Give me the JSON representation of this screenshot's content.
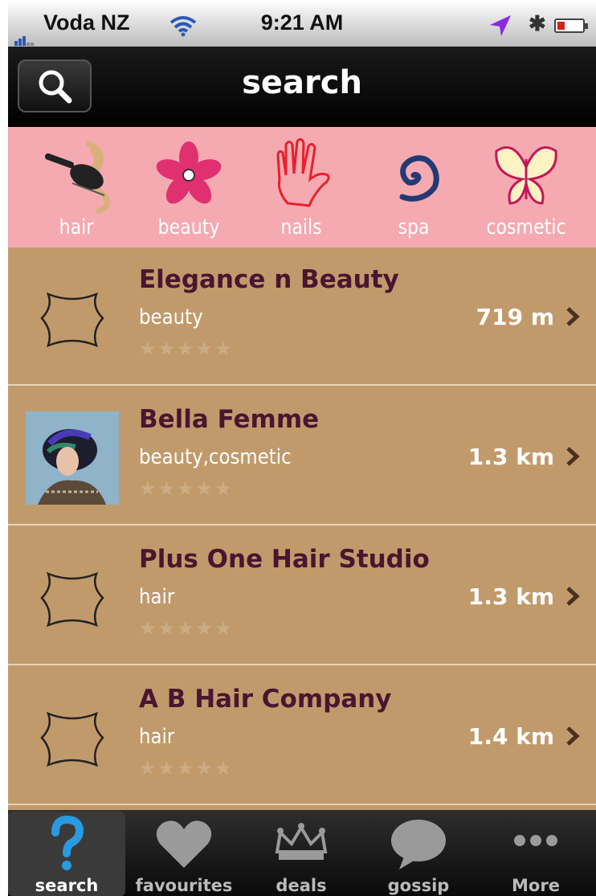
{
  "status_bar": {
    "carrier": "Voda NZ",
    "time": "9:21 AM"
  },
  "nav": {
    "title": "search"
  },
  "categories": [
    {
      "label": "hair",
      "icon": "hairbrush-icon"
    },
    {
      "label": "beauty",
      "icon": "flower-icon"
    },
    {
      "label": "nails",
      "icon": "hand-icon"
    },
    {
      "label": "spa",
      "icon": "spiral-icon"
    },
    {
      "label": "cosmetic",
      "icon": "butterfly-icon"
    }
  ],
  "results": [
    {
      "name": "Elegance n Beauty",
      "category": "beauty",
      "distance": "719 m",
      "thumb": "shield-placeholder-icon"
    },
    {
      "name": "Bella Femme",
      "category": "beauty,cosmetic",
      "distance": "1.3 km",
      "thumb": "salon-photo"
    },
    {
      "name": "Plus One Hair Studio",
      "category": "hair",
      "distance": "1.3 km",
      "thumb": "shield-placeholder-icon"
    },
    {
      "name": "A B Hair Company",
      "category": "hair",
      "distance": "1.4 km",
      "thumb": "shield-placeholder-icon"
    }
  ],
  "tabs": [
    {
      "label": "search",
      "icon": "question-mark-icon",
      "active": true
    },
    {
      "label": "favourites",
      "icon": "heart-icon",
      "active": false
    },
    {
      "label": "deals",
      "icon": "crown-icon",
      "active": false
    },
    {
      "label": "gossip",
      "icon": "speech-bubble-icon",
      "active": false
    },
    {
      "label": "More",
      "icon": "more-dots-icon",
      "active": false
    }
  ],
  "colors": {
    "category_bar": "#f4aab0",
    "list_background": "#c19a6b",
    "business_name": "#4a1530",
    "nav_background": "#000000"
  }
}
